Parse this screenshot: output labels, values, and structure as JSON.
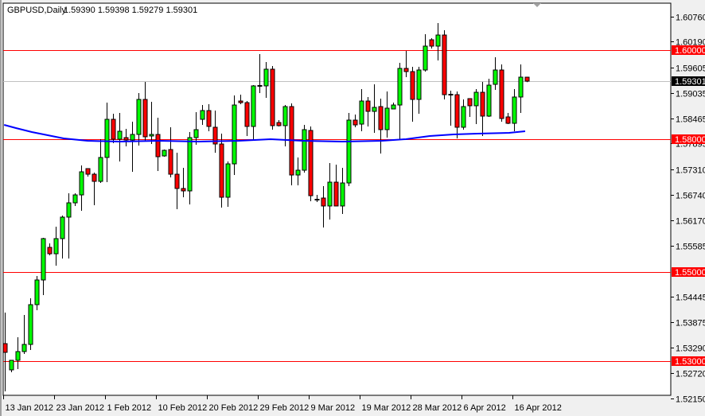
{
  "header": {
    "symbol_timeframe": "GBPUSD,Daily",
    "ohlc_text": "1.59390 1.59398 1.59279 1.59301"
  },
  "colors": {
    "bull": "#00ff00",
    "bear": "#ff0000",
    "ma": "#0000ff",
    "level_line": "#ff0000",
    "bid_line": "#c0c0c0"
  },
  "chart_data": {
    "type": "candlestick",
    "title": "GBPUSD,Daily",
    "ylim": [
      1.5215,
      1.6085
    ],
    "y_ticks": [
      "1.60760",
      "1.60190",
      "1.59605",
      "1.59035",
      "1.58465",
      "1.57895",
      "1.57310",
      "1.56740",
      "1.56170",
      "1.55585",
      "1.54445",
      "1.53875",
      "1.53290",
      "1.52720",
      "1.52150"
    ],
    "x_tick_labels": [
      {
        "index": 0,
        "label": "13 Jan 2012"
      },
      {
        "index": 8,
        "label": "23 Jan 2012"
      },
      {
        "index": 16,
        "label": "1 Feb 2012"
      },
      {
        "index": 24,
        "label": "10 Feb 2012"
      },
      {
        "index": 32,
        "label": "20 Feb 2012"
      },
      {
        "index": 40,
        "label": "29 Feb 2012"
      },
      {
        "index": 48,
        "label": "9 Mar 2012"
      },
      {
        "index": 56,
        "label": "19 Mar 2012"
      },
      {
        "index": 64,
        "label": "28 Mar 2012"
      },
      {
        "index": 72,
        "label": "6 Apr 2012"
      },
      {
        "index": 80,
        "label": "16 Apr 2012"
      }
    ],
    "horizontal_levels": [
      {
        "price": 1.6,
        "label": "1.60000"
      },
      {
        "price": 1.58,
        "label": "1.58000"
      },
      {
        "price": 1.55,
        "label": "1.55000"
      },
      {
        "price": 1.53,
        "label": "1.53000"
      }
    ],
    "bid": {
      "price": 1.59301,
      "label": "1.59301"
    },
    "ohlc": [
      [
        1.53387,
        1.54086,
        1.52312,
        1.5319
      ],
      [
        1.52796,
        1.53011,
        1.52742,
        1.53011
      ],
      [
        1.53011,
        1.5353,
        1.52814,
        1.53208
      ],
      [
        1.53208,
        1.54032,
        1.53154,
        1.53369
      ],
      [
        1.53369,
        1.54409,
        1.53244,
        1.54265
      ],
      [
        1.54265,
        1.5491,
        1.5414,
        1.54821
      ],
      [
        1.54821,
        1.55771,
        1.5448,
        1.55753
      ],
      [
        1.55556,
        1.55645,
        1.55376,
        1.55412
      ],
      [
        1.55412,
        1.56022,
        1.55143,
        1.55753
      ],
      [
        1.55753,
        1.56272,
        1.55305,
        1.56237
      ],
      [
        1.56237,
        1.56774,
        1.55305,
        1.56559
      ],
      [
        1.56559,
        1.56774,
        1.56488,
        1.56738
      ],
      [
        1.56738,
        1.57401,
        1.5638,
        1.57258
      ],
      [
        1.5733,
        1.5733,
        1.57151,
        1.57204
      ],
      [
        1.57204,
        1.5724,
        1.56505,
        1.57043
      ],
      [
        1.57043,
        1.57993,
        1.57007,
        1.57581
      ],
      [
        1.57581,
        1.58817,
        1.57025,
        1.58441
      ],
      [
        1.58441,
        1.58566,
        1.57903,
        1.57993
      ],
      [
        1.57993,
        1.58584,
        1.57491,
        1.58172
      ],
      [
        1.58029,
        1.58226,
        1.57832,
        1.57975
      ],
      [
        1.57975,
        1.58387,
        1.57258,
        1.581
      ],
      [
        1.581,
        1.59032,
        1.57849,
        1.58889
      ],
      [
        1.58889,
        1.59283,
        1.57939,
        1.58047
      ],
      [
        1.58065,
        1.58835,
        1.57885,
        1.581
      ],
      [
        1.581,
        1.58477,
        1.57276,
        1.57598
      ],
      [
        1.57616,
        1.5776,
        1.57598,
        1.57742
      ],
      [
        1.5776,
        1.58262,
        1.57133,
        1.57204
      ],
      [
        1.57204,
        1.57688,
        1.56416,
        1.56882
      ],
      [
        1.56882,
        1.57348,
        1.56685,
        1.56828
      ],
      [
        1.56828,
        1.58154,
        1.56523,
        1.58029
      ],
      [
        1.58029,
        1.58602,
        1.57867,
        1.58208
      ],
      [
        1.58441,
        1.58763,
        1.58315,
        1.58638
      ],
      [
        1.58638,
        1.58781,
        1.58172,
        1.5828
      ],
      [
        1.58262,
        1.58638,
        1.57688,
        1.57885
      ],
      [
        1.57885,
        1.58118,
        1.56452,
        1.56685
      ],
      [
        1.56685,
        1.57491,
        1.5647,
        1.57437
      ],
      [
        1.57437,
        1.58978,
        1.57186,
        1.58763
      ],
      [
        1.58853,
        1.58996,
        1.58781,
        1.58817
      ],
      [
        1.58817,
        1.58853,
        1.58065,
        1.5828
      ],
      [
        1.5828,
        1.59211,
        1.57957,
        1.59194
      ],
      [
        1.59194,
        1.5991,
        1.59032,
        1.59194
      ],
      [
        1.59194,
        1.59731,
        1.58925,
        1.5957
      ],
      [
        1.5957,
        1.59642,
        1.58208,
        1.58298
      ],
      [
        1.58369,
        1.58423,
        1.5828,
        1.58298
      ],
      [
        1.58298,
        1.58763,
        1.57832,
        1.58728
      ],
      [
        1.58728,
        1.58799,
        1.56953,
        1.57186
      ],
      [
        1.57186,
        1.57581,
        1.56953,
        1.57294
      ],
      [
        1.57294,
        1.58315,
        1.5724,
        1.58208
      ],
      [
        1.5819,
        1.5828,
        1.56595,
        1.5672
      ],
      [
        1.56631,
        1.56738,
        1.56577,
        1.56631
      ],
      [
        1.56667,
        1.56935,
        1.56004,
        1.56488
      ],
      [
        1.56488,
        1.57455,
        1.56183,
        1.57025
      ],
      [
        1.57025,
        1.57419,
        1.56488,
        1.56488
      ],
      [
        1.56488,
        1.57348,
        1.56308,
        1.57007
      ],
      [
        1.57007,
        1.58584,
        1.56935,
        1.58423
      ],
      [
        1.58423,
        1.58548,
        1.58262,
        1.58315
      ],
      [
        1.58333,
        1.59122,
        1.58172,
        1.58853
      ],
      [
        1.58853,
        1.58943,
        1.5828,
        1.5862
      ],
      [
        1.5862,
        1.59229,
        1.58136,
        1.5871
      ],
      [
        1.58728,
        1.58907,
        1.5767,
        1.58208
      ],
      [
        1.58208,
        1.59068,
        1.58029,
        1.58692
      ],
      [
        1.58674,
        1.58817,
        1.58674,
        1.58763
      ],
      [
        1.58763,
        1.59713,
        1.57993,
        1.59588
      ],
      [
        1.59588,
        1.59982,
        1.59391,
        1.59516
      ],
      [
        1.59516,
        1.59624,
        1.58387,
        1.58889
      ],
      [
        1.58889,
        1.59624,
        1.58566,
        1.59552
      ],
      [
        1.59552,
        1.60358,
        1.59516,
        1.6009
      ],
      [
        1.60233,
        1.60269,
        1.60036,
        1.6009
      ],
      [
        1.6009,
        1.60609,
        1.59767,
        1.6034
      ],
      [
        1.6034,
        1.60448,
        1.58889,
        1.58996
      ],
      [
        1.58996,
        1.59086,
        1.58298,
        1.58996
      ],
      [
        1.58996,
        1.59068,
        1.58011,
        1.58262
      ],
      [
        1.58262,
        1.58889,
        1.58208,
        1.58728
      ],
      [
        1.58907,
        1.58907,
        1.58495,
        1.58746
      ],
      [
        1.58746,
        1.59122,
        1.58333,
        1.5905
      ],
      [
        1.5905,
        1.59283,
        1.58065,
        1.58513
      ],
      [
        1.58513,
        1.59355,
        1.58495,
        1.59211
      ],
      [
        1.59229,
        1.59839,
        1.59104,
        1.59552
      ],
      [
        1.59552,
        1.59677,
        1.58387,
        1.58459
      ],
      [
        1.58495,
        1.58584,
        1.58333,
        1.58351
      ],
      [
        1.58351,
        1.59122,
        1.58172,
        1.58943
      ],
      [
        1.58943,
        1.59677,
        1.58584,
        1.59391
      ],
      [
        1.5939,
        1.59398,
        1.59279,
        1.59301
      ]
    ],
    "moving_average": [
      [
        -0.1,
        1.58315
      ],
      [
        1.75,
        1.58244
      ],
      [
        4.25,
        1.58154
      ],
      [
        6.75,
        1.58082
      ],
      [
        9.25,
        1.58011
      ],
      [
        13,
        1.57957
      ],
      [
        18,
        1.57939
      ],
      [
        24.25,
        1.57957
      ],
      [
        30.5,
        1.57939
      ],
      [
        36.75,
        1.57957
      ],
      [
        41.75,
        1.57993
      ],
      [
        46.75,
        1.57957
      ],
      [
        53,
        1.57939
      ],
      [
        59.25,
        1.57957
      ],
      [
        63,
        1.57993
      ],
      [
        66.75,
        1.58065
      ],
      [
        70.5,
        1.581
      ],
      [
        74.25,
        1.58118
      ],
      [
        79.25,
        1.58136
      ],
      [
        81.75,
        1.58172
      ]
    ]
  }
}
